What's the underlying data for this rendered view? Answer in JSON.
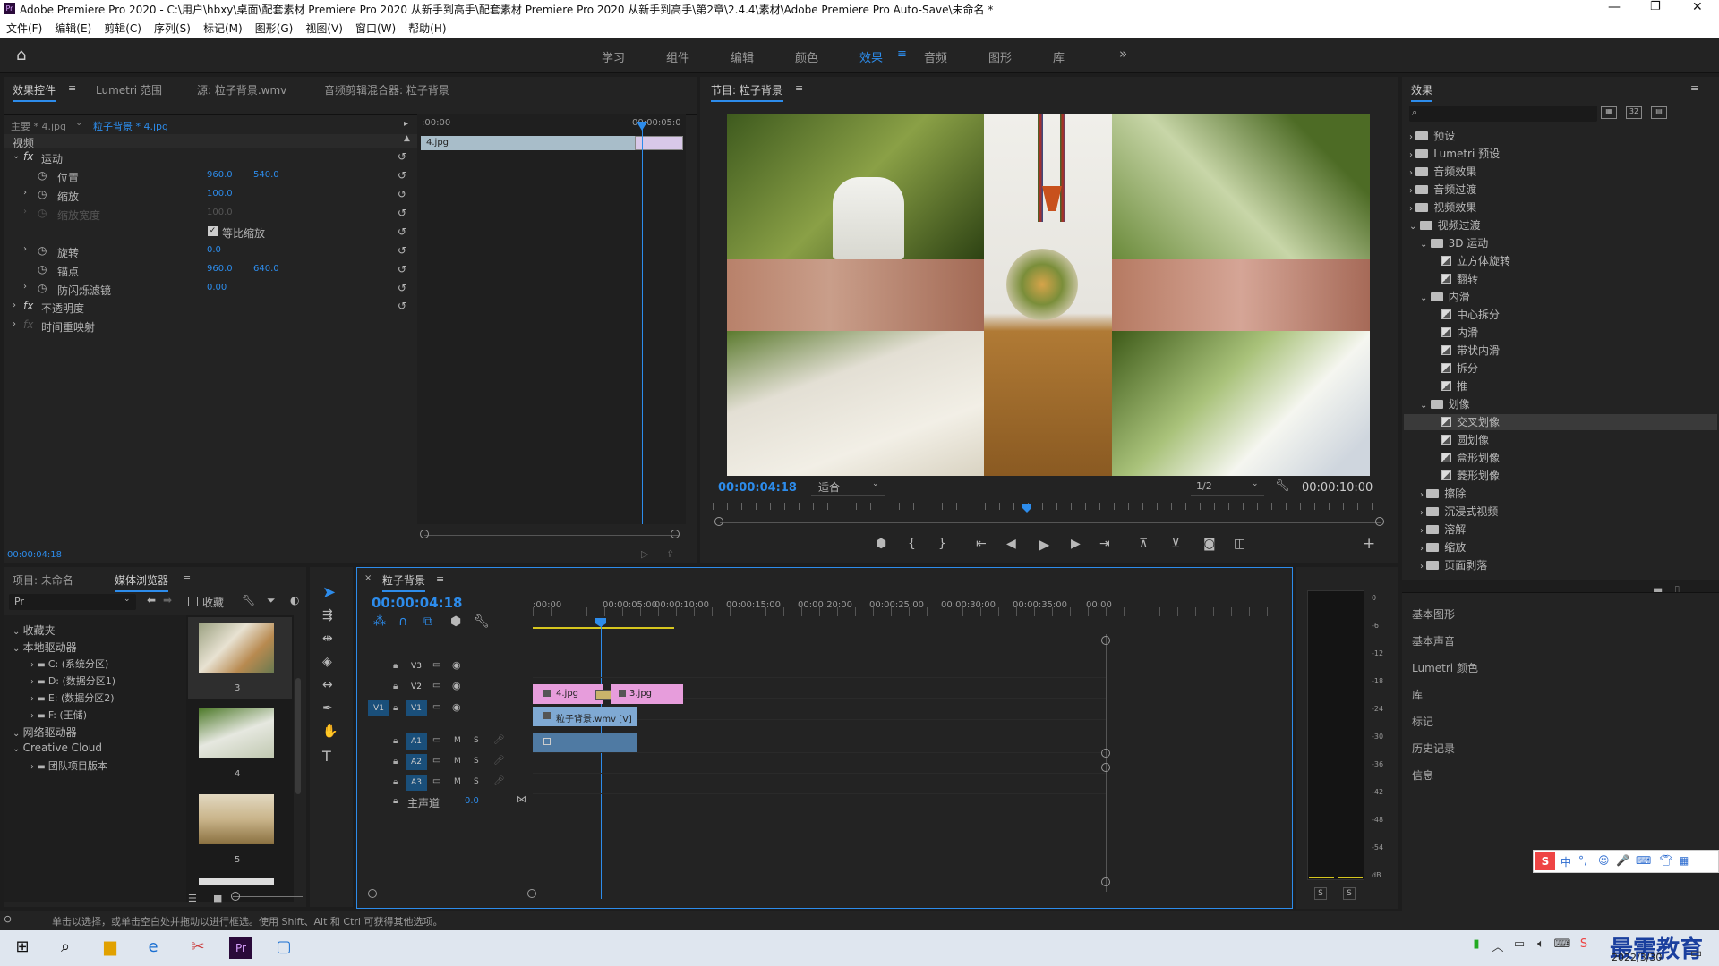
{
  "window": {
    "title": "Adobe Premiere Pro 2020 - C:\\用户\\hbxy\\桌面\\配套素材 Premiere Pro 2020 从新手到高手\\配套素材 Premiere Pro 2020 从新手到高手\\第2章\\2.4.4\\素材\\Adobe Premiere Pro Auto-Save\\未命名 *",
    "app_icon": "Pr"
  },
  "menu": [
    "文件(F)",
    "编辑(E)",
    "剪辑(C)",
    "序列(S)",
    "标记(M)",
    "图形(G)",
    "视图(V)",
    "窗口(W)",
    "帮助(H)"
  ],
  "workspaces": [
    "学习",
    "组件",
    "编辑",
    "颜色",
    "效果",
    "音频",
    "图形",
    "库"
  ],
  "active_workspace": "效果",
  "effect_controls": {
    "tabs": [
      "效果控件",
      "Lumetri 范围",
      "源: 粒子背景.wmv",
      "音频剪辑混合器: 粒子背景"
    ],
    "master": "主要 * 4.jpg",
    "clip": "粒子背景 * 4.jpg",
    "ruler_start": ":00:00",
    "ruler_end": "00:00:05:0",
    "clip_label": "4.jpg",
    "section_video": "视频",
    "motion": "运动",
    "position_label": "位置",
    "position_x": "960.0",
    "position_y": "540.0",
    "scale_label": "缩放",
    "scale_value": "100.0",
    "scale_width_label": "缩放宽度",
    "scale_width_value": "100.0",
    "uniform_label": "等比缩放",
    "rotation_label": "旋转",
    "rotation_value": "0.0",
    "anchor_label": "锚点",
    "anchor_x": "960.0",
    "anchor_y": "640.0",
    "flicker_label": "防闪烁滤镜",
    "flicker_value": "0.00",
    "opacity_label": "不透明度",
    "timeremap_label": "时间重映射",
    "timecode": "00:00:04:18"
  },
  "program": {
    "title": "节目: 粒子背景",
    "timecode": "00:00:04:18",
    "fit": "适合",
    "quality": "1/2",
    "duration": "00:00:10:00"
  },
  "effects_panel": {
    "title": "效果",
    "items": [
      {
        "label": "预设",
        "level": 0,
        "type": "folder",
        "open": false
      },
      {
        "label": "Lumetri 预设",
        "level": 0,
        "type": "folder",
        "open": false
      },
      {
        "label": "音频效果",
        "level": 0,
        "type": "folder",
        "open": false
      },
      {
        "label": "音频过渡",
        "level": 0,
        "type": "folder",
        "open": false
      },
      {
        "label": "视频效果",
        "level": 0,
        "type": "folder",
        "open": false
      },
      {
        "label": "视频过渡",
        "level": 0,
        "type": "folder",
        "open": true
      },
      {
        "label": "3D 运动",
        "level": 1,
        "type": "folder",
        "open": true
      },
      {
        "label": "立方体旋转",
        "level": 2,
        "type": "effect"
      },
      {
        "label": "翻转",
        "level": 2,
        "type": "effect"
      },
      {
        "label": "内滑",
        "level": 1,
        "type": "folder",
        "open": true
      },
      {
        "label": "中心拆分",
        "level": 2,
        "type": "effect"
      },
      {
        "label": "内滑",
        "level": 2,
        "type": "effect"
      },
      {
        "label": "带状内滑",
        "level": 2,
        "type": "effect"
      },
      {
        "label": "拆分",
        "level": 2,
        "type": "effect"
      },
      {
        "label": "推",
        "level": 2,
        "type": "effect"
      },
      {
        "label": "划像",
        "level": 1,
        "type": "folder",
        "open": true
      },
      {
        "label": "交叉划像",
        "level": 2,
        "type": "effect",
        "selected": true
      },
      {
        "label": "圆划像",
        "level": 2,
        "type": "effect"
      },
      {
        "label": "盒形划像",
        "level": 2,
        "type": "effect"
      },
      {
        "label": "菱形划像",
        "level": 2,
        "type": "effect"
      },
      {
        "label": "擦除",
        "level": 1,
        "type": "folder",
        "open": false
      },
      {
        "label": "沉浸式视频",
        "level": 1,
        "type": "folder",
        "open": false
      },
      {
        "label": "溶解",
        "level": 1,
        "type": "folder",
        "open": false
      },
      {
        "label": "缩放",
        "level": 1,
        "type": "folder",
        "open": false
      },
      {
        "label": "页面剥落",
        "level": 1,
        "type": "folder",
        "open": false
      }
    ],
    "side_panels": [
      "基本图形",
      "基本声音",
      "Lumetri 颜色",
      "库",
      "标记",
      "历史记录",
      "信息"
    ]
  },
  "project": {
    "tabs": [
      "项目: 未命名",
      "媒体浏览器"
    ],
    "filter": "Pr",
    "collect_label": "收藏",
    "tree": [
      {
        "label": "收藏夹",
        "level": 0
      },
      {
        "label": "本地驱动器",
        "level": 0
      },
      {
        "label": "C: (系统分区)",
        "level": 1
      },
      {
        "label": "D: (数据分区1)",
        "level": 1
      },
      {
        "label": "E: (数据分区2)",
        "level": 1
      },
      {
        "label": "F: (王储)",
        "level": 1
      },
      {
        "label": "网络驱动器",
        "level": 0
      },
      {
        "label": "Creative Cloud",
        "level": 0
      },
      {
        "label": "团队项目版本",
        "level": 1
      }
    ],
    "thumbs": [
      "3",
      "4",
      "5"
    ]
  },
  "timeline": {
    "title": "粒子背景",
    "timecode": "00:00:04:18",
    "ruler": [
      ":00:00",
      "00:00:05:00",
      "00:00:10:00",
      "00:00:15:00",
      "00:00:20:00",
      "00:00:25:00",
      "00:00:30:00",
      "00:00:35:00",
      "00:00"
    ],
    "video_tracks": [
      "V3",
      "V2",
      "V1"
    ],
    "audio_tracks": [
      "A1",
      "A2",
      "A3"
    ],
    "source_patch": "V1",
    "master_label": "主声道",
    "master_value": "0.0",
    "clips": {
      "v2a": "4.jpg",
      "v2b": "3.jpg",
      "v1": "粒子背景.wmv [V]"
    }
  },
  "meter": {
    "scale": [
      "0",
      "-6",
      "-12",
      "-18",
      "-24",
      "-30",
      "-36",
      "-42",
      "-48",
      "-54",
      "dB"
    ],
    "solo": [
      "S",
      "S"
    ]
  },
  "status": "单击以选择，或单击空白处并拖动以进行框选。使用 Shift、Alt 和 Ctrl 可获得其他选项。",
  "watermark": "最需教育",
  "clock_date": "2022/3/30",
  "ime": [
    "中",
    "°,",
    "☺",
    "🎤",
    "⌨"
  ]
}
